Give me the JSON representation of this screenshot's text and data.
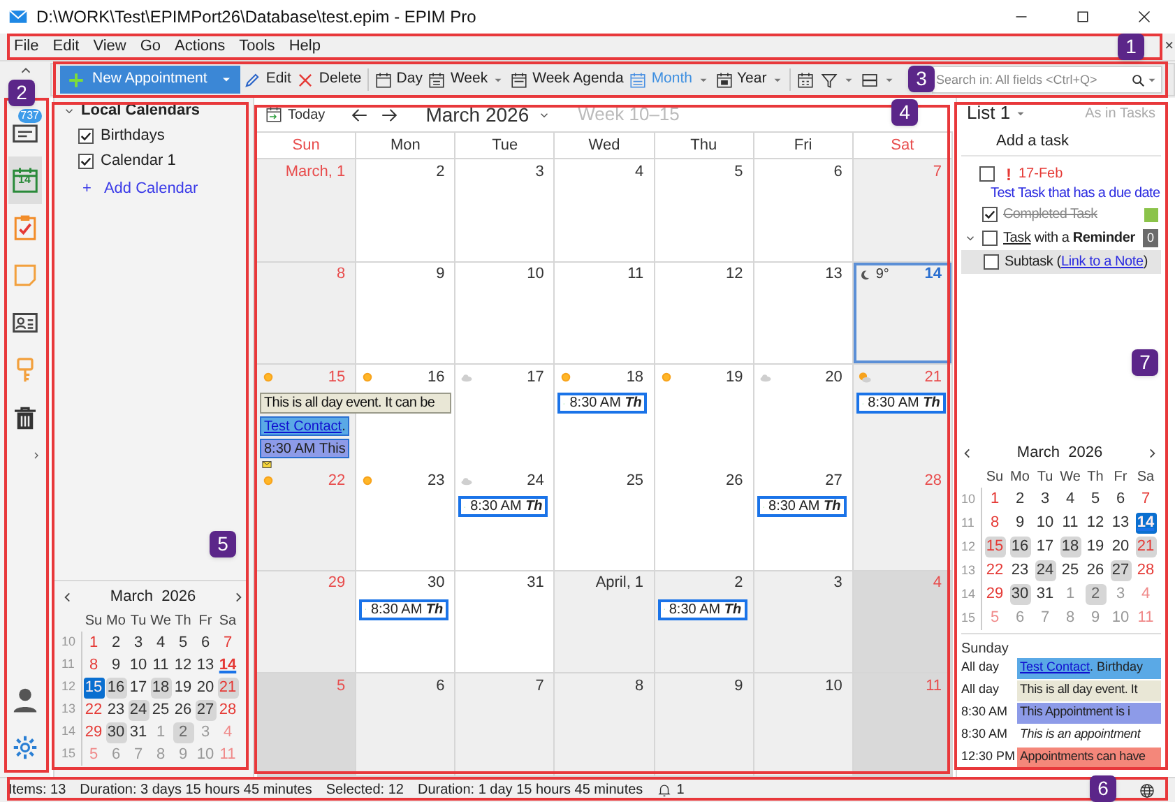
{
  "window": {
    "title": "D:\\WORK\\Test\\EPIMPort26\\Database\\test.epim - EPIM Pro"
  },
  "menu": {
    "items": [
      "File",
      "Edit",
      "View",
      "Go",
      "Actions",
      "Tools",
      "Help"
    ],
    "close_glyph": "×"
  },
  "toolbar": [
    {
      "kind": "new",
      "label": "New Appointment",
      "dropdown": true
    },
    {
      "kind": "edit",
      "label": "Edit",
      "dropdown": false
    },
    {
      "kind": "delete",
      "label": "Delete",
      "dropdown": false
    },
    {
      "kind": "day",
      "label": "Day",
      "dropdown": false,
      "selected": false
    },
    {
      "kind": "week",
      "label": "Week",
      "dropdown": true,
      "selected": false
    },
    {
      "kind": "week-agenda",
      "label": "Week Agenda",
      "dropdown": false,
      "selected": false
    },
    {
      "kind": "month",
      "label": "Month",
      "dropdown": true,
      "selected": true
    },
    {
      "kind": "year",
      "label": "Year",
      "dropdown": true,
      "selected": false
    },
    {
      "kind": "go-to-date",
      "dropdown": false
    },
    {
      "kind": "filter",
      "dropdown": true
    },
    {
      "kind": "layout",
      "dropdown": true
    }
  ],
  "search": {
    "placeholder": "Search in: All fields <Ctrl+Q>"
  },
  "nav": [
    {
      "kind": "mail",
      "badge": "737",
      "selected": false
    },
    {
      "kind": "calendar",
      "date": "14",
      "selected": true
    },
    {
      "kind": "tasks",
      "selected": false
    },
    {
      "kind": "notes",
      "selected": false
    },
    {
      "kind": "contacts",
      "selected": false
    },
    {
      "kind": "passwords",
      "selected": false
    },
    {
      "kind": "trash",
      "selected": false
    },
    {
      "kind": "expand",
      "selected": false
    },
    {
      "kind": "spacer"
    },
    {
      "kind": "account",
      "selected": false
    },
    {
      "kind": "settings",
      "selected": false
    }
  ],
  "left_panel": {
    "tree": {
      "label": "Local Calendars",
      "expanded": true,
      "children": [
        {
          "label": "Birthdays",
          "checked": true
        },
        {
          "label": "Calendar 1",
          "checked": true
        }
      ]
    },
    "add_link": {
      "glyph": "+",
      "label": "Add Calendar"
    },
    "mini_calendar": {
      "month": "March",
      "year": "2026",
      "weekdays": [
        "Su",
        "Mo",
        "Tu",
        "We",
        "Th",
        "Fr",
        "Sa"
      ],
      "weeks": [
        {
          "number": "10",
          "days": [
            {
              "day": "1",
              "kind": "weekend",
              "busy": false,
              "selected": false,
              "today": false
            },
            {
              "day": "2",
              "kind": "weekday",
              "busy": false,
              "selected": false,
              "today": false
            },
            {
              "day": "3",
              "kind": "weekday",
              "busy": false,
              "selected": false,
              "today": false
            },
            {
              "day": "4",
              "kind": "weekday",
              "busy": false,
              "selected": false,
              "today": false
            },
            {
              "day": "5",
              "kind": "weekday",
              "busy": false,
              "selected": false,
              "today": false
            },
            {
              "day": "6",
              "kind": "weekday",
              "busy": false,
              "selected": false,
              "today": false
            },
            {
              "day": "7",
              "kind": "weekend",
              "busy": false,
              "selected": false,
              "today": false
            }
          ]
        },
        {
          "number": "11",
          "days": [
            {
              "day": "8",
              "kind": "weekend",
              "busy": false,
              "selected": false,
              "today": false
            },
            {
              "day": "9",
              "kind": "weekday",
              "busy": false,
              "selected": false,
              "today": false
            },
            {
              "day": "10",
              "kind": "weekday",
              "busy": false,
              "selected": false,
              "today": false
            },
            {
              "day": "11",
              "kind": "weekday",
              "busy": false,
              "selected": false,
              "today": false
            },
            {
              "day": "12",
              "kind": "weekday",
              "busy": false,
              "selected": false,
              "today": false
            },
            {
              "day": "13",
              "kind": "weekday",
              "busy": false,
              "selected": false,
              "today": false
            },
            {
              "day": "14",
              "kind": "weekend",
              "busy": false,
              "selected": false,
              "today": true
            }
          ]
        },
        {
          "number": "12",
          "days": [
            {
              "day": "15",
              "kind": "weekend",
              "busy": false,
              "selected": true,
              "today": false
            },
            {
              "day": "16",
              "kind": "weekday",
              "busy": true,
              "selected": false,
              "today": false
            },
            {
              "day": "17",
              "kind": "weekday",
              "busy": false,
              "selected": false,
              "today": false
            },
            {
              "day": "18",
              "kind": "weekday",
              "busy": true,
              "selected": false,
              "today": false
            },
            {
              "day": "19",
              "kind": "weekday",
              "busy": false,
              "selected": false,
              "today": false
            },
            {
              "day": "20",
              "kind": "weekday",
              "busy": false,
              "selected": false,
              "today": false
            },
            {
              "day": "21",
              "kind": "weekend",
              "busy": true,
              "selected": false,
              "today": false
            }
          ]
        },
        {
          "number": "13",
          "days": [
            {
              "day": "22",
              "kind": "weekend",
              "busy": false,
              "selected": false,
              "today": false
            },
            {
              "day": "23",
              "kind": "weekday",
              "busy": false,
              "selected": false,
              "today": false
            },
            {
              "day": "24",
              "kind": "weekday",
              "busy": true,
              "selected": false,
              "today": false
            },
            {
              "day": "25",
              "kind": "weekday",
              "busy": false,
              "selected": false,
              "today": false
            },
            {
              "day": "26",
              "kind": "weekday",
              "busy": false,
              "selected": false,
              "today": false
            },
            {
              "day": "27",
              "kind": "weekday",
              "busy": true,
              "selected": false,
              "today": false
            },
            {
              "day": "28",
              "kind": "weekend",
              "busy": false,
              "selected": false,
              "today": false
            }
          ]
        },
        {
          "number": "14",
          "days": [
            {
              "day": "29",
              "kind": "weekend",
              "busy": false,
              "selected": false,
              "today": false
            },
            {
              "day": "30",
              "kind": "weekday",
              "busy": true,
              "selected": false,
              "today": false
            },
            {
              "day": "31",
              "kind": "weekday",
              "busy": false,
              "selected": false,
              "today": false
            },
            {
              "day": "1",
              "kind": "other-month",
              "busy": false,
              "selected": false,
              "today": false
            },
            {
              "day": "2",
              "kind": "other-month",
              "busy": true,
              "selected": false,
              "today": false
            },
            {
              "day": "3",
              "kind": "other-month",
              "busy": false,
              "selected": false,
              "today": false
            },
            {
              "day": "4",
              "kind": "other-month-weekend",
              "busy": false,
              "selected": false,
              "today": false
            }
          ]
        },
        {
          "number": "15",
          "days": [
            {
              "day": "5",
              "kind": "other-month-weekend",
              "busy": false,
              "selected": false,
              "today": false
            },
            {
              "day": "6",
              "kind": "other-month",
              "busy": false,
              "selected": false,
              "today": false
            },
            {
              "day": "7",
              "kind": "other-month",
              "busy": false,
              "selected": false,
              "today": false
            },
            {
              "day": "8",
              "kind": "other-month",
              "busy": false,
              "selected": false,
              "today": false
            },
            {
              "day": "9",
              "kind": "other-month",
              "busy": false,
              "selected": false,
              "today": false
            },
            {
              "day": "10",
              "kind": "other-month",
              "busy": false,
              "selected": false,
              "today": false
            },
            {
              "day": "11",
              "kind": "other-month-weekend",
              "busy": false,
              "selected": false,
              "today": false
            }
          ]
        }
      ]
    }
  },
  "calendar": {
    "today_label": "Today",
    "title": "March 2026",
    "week_range": "Week 10–15",
    "weekdays": [
      {
        "label": "Sun",
        "weekend": true
      },
      {
        "label": "Mon",
        "weekend": false
      },
      {
        "label": "Tue",
        "weekend": false
      },
      {
        "label": "Wed",
        "weekend": false
      },
      {
        "label": "Thu",
        "weekend": false
      },
      {
        "label": "Fri",
        "weekend": false
      },
      {
        "label": "Sat",
        "weekend": true
      }
    ],
    "weeks": [
      [
        {
          "day": "March, 1",
          "kind": "weekend",
          "selected": false
        },
        {
          "day": "2",
          "kind": "weekday",
          "selected": false
        },
        {
          "day": "3",
          "kind": "weekday",
          "selected": false
        },
        {
          "day": "4",
          "kind": "weekday",
          "selected": false
        },
        {
          "day": "5",
          "kind": "weekday",
          "selected": false
        },
        {
          "day": "6",
          "kind": "weekday",
          "selected": false
        },
        {
          "day": "7",
          "kind": "weekend",
          "selected": false
        }
      ],
      [
        {
          "day": "8",
          "kind": "weekend",
          "selected": false
        },
        {
          "day": "9",
          "kind": "weekday",
          "selected": false
        },
        {
          "day": "10",
          "kind": "weekday",
          "selected": false
        },
        {
          "day": "11",
          "kind": "weekday",
          "selected": false
        },
        {
          "day": "12",
          "kind": "weekday",
          "selected": false
        },
        {
          "day": "13",
          "kind": "weekday",
          "selected": false
        },
        {
          "day": "14",
          "kind": "weekend",
          "selected": true,
          "weather": {
            "kind": "moon",
            "temp": "9°"
          }
        }
      ],
      [
        {
          "day": "15",
          "kind": "weekend",
          "selected": false,
          "weather": {
            "kind": "sun"
          },
          "events": [
            {
              "kind": "all-day",
              "text": "This is all day event. It can be",
              "continues_next_day": true,
              "color": "#e9e7d6"
            },
            {
              "kind": "birthday",
              "link": "Test Contact",
              "text": ".",
              "color": "#5aa9e6"
            },
            {
              "kind": "appointment",
              "time": "8:30 AM",
              "title": "This",
              "color": "#8d9be8"
            },
            {
              "kind": "more"
            }
          ]
        },
        {
          "day": "16",
          "kind": "weekday",
          "selected": false,
          "weather": {
            "kind": "sun"
          }
        },
        {
          "day": "17",
          "kind": "weekday",
          "selected": false,
          "weather": {
            "kind": "cloud"
          }
        },
        {
          "day": "18",
          "kind": "weekday",
          "selected": false,
          "weather": {
            "kind": "sun"
          },
          "events": [
            {
              "kind": "recurring",
              "time": "8:30 AM",
              "title": "Th"
            }
          ]
        },
        {
          "day": "19",
          "kind": "weekday",
          "selected": false,
          "weather": {
            "kind": "sun"
          }
        },
        {
          "day": "20",
          "kind": "weekday",
          "selected": false,
          "weather": {
            "kind": "cloud"
          }
        },
        {
          "day": "21",
          "kind": "weekend",
          "selected": false,
          "weather": {
            "kind": "partly-cloudy"
          },
          "events": [
            {
              "kind": "recurring",
              "time": "8:30 AM",
              "title": "Th"
            }
          ]
        }
      ],
      [
        {
          "day": "22",
          "kind": "weekend",
          "selected": false,
          "weather": {
            "kind": "sun"
          }
        },
        {
          "day": "23",
          "kind": "weekday",
          "selected": false,
          "weather": {
            "kind": "sun"
          }
        },
        {
          "day": "24",
          "kind": "weekday",
          "selected": false,
          "weather": {
            "kind": "cloud"
          },
          "events": [
            {
              "kind": "recurring",
              "time": "8:30 AM",
              "title": "Th"
            }
          ]
        },
        {
          "day": "25",
          "kind": "weekday",
          "selected": false
        },
        {
          "day": "26",
          "kind": "weekday",
          "selected": false
        },
        {
          "day": "27",
          "kind": "weekday",
          "selected": false,
          "events": [
            {
              "kind": "recurring",
              "time": "8:30 AM",
              "title": "Th"
            }
          ]
        },
        {
          "day": "28",
          "kind": "weekend",
          "selected": false
        }
      ],
      [
        {
          "day": "29",
          "kind": "weekend",
          "selected": false
        },
        {
          "day": "30",
          "kind": "weekday",
          "selected": false,
          "events": [
            {
              "kind": "recurring",
              "time": "8:30 AM",
              "title": "Th"
            }
          ]
        },
        {
          "day": "31",
          "kind": "weekday",
          "selected": false
        },
        {
          "day": "April, 1",
          "kind": "other-month",
          "selected": false
        },
        {
          "day": "2",
          "kind": "other-month",
          "selected": false,
          "events": [
            {
              "kind": "recurring",
              "time": "8:30 AM",
              "title": "Th"
            }
          ]
        },
        {
          "day": "3",
          "kind": "other-month",
          "selected": false
        },
        {
          "day": "4",
          "kind": "other-month-weekend",
          "selected": false
        }
      ],
      [
        {
          "day": "5",
          "kind": "other-month-weekend",
          "selected": false
        },
        {
          "day": "6",
          "kind": "other-month",
          "selected": false
        },
        {
          "day": "7",
          "kind": "other-month",
          "selected": false
        },
        {
          "day": "8",
          "kind": "other-month",
          "selected": false
        },
        {
          "day": "9",
          "kind": "other-month",
          "selected": false
        },
        {
          "day": "10",
          "kind": "other-month",
          "selected": false
        },
        {
          "day": "11",
          "kind": "other-month-weekend",
          "selected": false
        }
      ]
    ]
  },
  "right_panel": {
    "list_title": "List 1",
    "sort_label": "As in Tasks",
    "add_task": "Add a task",
    "tasks": [
      {
        "checked": false,
        "selected": false,
        "priority": "!",
        "due": "17-Feb",
        "title": "Test Task that has a due date"
      },
      {
        "checked": true,
        "selected": false,
        "color": "#8bc34a",
        "title": "Completed Task"
      },
      {
        "checked": false,
        "selected": false,
        "expanded": true,
        "badge": "0",
        "parts": [
          {
            "kind": "underlined",
            "text": "Task"
          },
          {
            "kind": "text",
            "text": " with a "
          },
          {
            "kind": "bold",
            "text": "Reminder"
          }
        ],
        "children": [
          {
            "checked": false,
            "selected": true,
            "parts": [
              {
                "kind": "text",
                "text": "Subtask ("
              },
              {
                "kind": "link",
                "text": "Link to a Note"
              },
              {
                "kind": "text",
                "text": ")"
              }
            ]
          }
        ]
      }
    ],
    "mini_calendar": {
      "month": "March",
      "year": "2026",
      "weekdays": [
        "Su",
        "Mo",
        "Tu",
        "We",
        "Th",
        "Fr",
        "Sa"
      ],
      "weeks": [
        {
          "number": "10",
          "days": [
            {
              "day": "1",
              "kind": "weekend",
              "busy": false,
              "selected": false,
              "today": false
            },
            {
              "day": "2",
              "kind": "weekday",
              "busy": false,
              "selected": false,
              "today": false
            },
            {
              "day": "3",
              "kind": "weekday",
              "busy": false,
              "selected": false,
              "today": false
            },
            {
              "day": "4",
              "kind": "weekday",
              "busy": false,
              "selected": false,
              "today": false
            },
            {
              "day": "5",
              "kind": "weekday",
              "busy": false,
              "selected": false,
              "today": false
            },
            {
              "day": "6",
              "kind": "weekday",
              "busy": false,
              "selected": false,
              "today": false
            },
            {
              "day": "7",
              "kind": "weekend",
              "busy": false,
              "selected": false,
              "today": false
            }
          ]
        },
        {
          "number": "11",
          "days": [
            {
              "day": "8",
              "kind": "weekend",
              "busy": false,
              "selected": false,
              "today": false
            },
            {
              "day": "9",
              "kind": "weekday",
              "busy": false,
              "selected": false,
              "today": false
            },
            {
              "day": "10",
              "kind": "weekday",
              "busy": false,
              "selected": false,
              "today": false
            },
            {
              "day": "11",
              "kind": "weekday",
              "busy": false,
              "selected": false,
              "today": false
            },
            {
              "day": "12",
              "kind": "weekday",
              "busy": false,
              "selected": false,
              "today": false
            },
            {
              "day": "13",
              "kind": "weekday",
              "busy": false,
              "selected": false,
              "today": false
            },
            {
              "day": "14",
              "kind": "weekend",
              "busy": false,
              "selected": true,
              "today": true
            }
          ]
        },
        {
          "number": "12",
          "days": [
            {
              "day": "15",
              "kind": "weekend",
              "busy": true,
              "selected": false,
              "today": false
            },
            {
              "day": "16",
              "kind": "weekday",
              "busy": true,
              "selected": false,
              "today": false
            },
            {
              "day": "17",
              "kind": "weekday",
              "busy": false,
              "selected": false,
              "today": false
            },
            {
              "day": "18",
              "kind": "weekday",
              "busy": true,
              "selected": false,
              "today": false
            },
            {
              "day": "19",
              "kind": "weekday",
              "busy": false,
              "selected": false,
              "today": false
            },
            {
              "day": "20",
              "kind": "weekday",
              "busy": false,
              "selected": false,
              "today": false
            },
            {
              "day": "21",
              "kind": "weekend",
              "busy": true,
              "selected": false,
              "today": false
            }
          ]
        },
        {
          "number": "13",
          "days": [
            {
              "day": "22",
              "kind": "weekend",
              "busy": false,
              "selected": false,
              "today": false
            },
            {
              "day": "23",
              "kind": "weekday",
              "busy": false,
              "selected": false,
              "today": false
            },
            {
              "day": "24",
              "kind": "weekday",
              "busy": true,
              "selected": false,
              "today": false
            },
            {
              "day": "25",
              "kind": "weekday",
              "busy": false,
              "selected": false,
              "today": false
            },
            {
              "day": "26",
              "kind": "weekday",
              "busy": false,
              "selected": false,
              "today": false
            },
            {
              "day": "27",
              "kind": "weekday",
              "busy": true,
              "selected": false,
              "today": false
            },
            {
              "day": "28",
              "kind": "weekend",
              "busy": false,
              "selected": false,
              "today": false
            }
          ]
        },
        {
          "number": "14",
          "days": [
            {
              "day": "29",
              "kind": "weekend",
              "busy": false,
              "selected": false,
              "today": false
            },
            {
              "day": "30",
              "kind": "weekday",
              "busy": true,
              "selected": false,
              "today": false
            },
            {
              "day": "31",
              "kind": "weekday",
              "busy": false,
              "selected": false,
              "today": false
            },
            {
              "day": "1",
              "kind": "other-month",
              "busy": false,
              "selected": false,
              "today": false
            },
            {
              "day": "2",
              "kind": "other-month",
              "busy": true,
              "selected": false,
              "today": false
            },
            {
              "day": "3",
              "kind": "other-month",
              "busy": false,
              "selected": false,
              "today": false
            },
            {
              "day": "4",
              "kind": "other-month-weekend",
              "busy": false,
              "selected": false,
              "today": false
            }
          ]
        },
        {
          "number": "15",
          "days": [
            {
              "day": "5",
              "kind": "other-month-weekend",
              "busy": false,
              "selected": false,
              "today": false
            },
            {
              "day": "6",
              "kind": "other-month",
              "busy": false,
              "selected": false,
              "today": false
            },
            {
              "day": "7",
              "kind": "other-month",
              "busy": false,
              "selected": false,
              "today": false
            },
            {
              "day": "8",
              "kind": "other-month",
              "busy": false,
              "selected": false,
              "today": false
            },
            {
              "day": "9",
              "kind": "other-month",
              "busy": false,
              "selected": false,
              "today": false
            },
            {
              "day": "10",
              "kind": "other-month",
              "busy": false,
              "selected": false,
              "today": false
            },
            {
              "day": "11",
              "kind": "other-month-weekend",
              "busy": false,
              "selected": false,
              "today": false
            }
          ]
        }
      ]
    },
    "agenda": {
      "day": "Sunday",
      "rows": [
        {
          "time": "All day",
          "kind": "birthday",
          "link": "Test Contact",
          "text": ". Birthday",
          "color": "#5aa9e6"
        },
        {
          "time": "All day",
          "kind": "event",
          "text": "This is all day event. It",
          "color": "#e9e7d6"
        },
        {
          "time": "8:30 AM",
          "kind": "event",
          "text": "This Appointment is i",
          "color": "#8d9be8"
        },
        {
          "time": "8:30 AM",
          "kind": "note",
          "text": "This is an appointment"
        },
        {
          "time": "12:30 PM",
          "kind": "event",
          "text": "Appointments can have",
          "color": "#f4877a"
        }
      ]
    }
  },
  "status_bar": {
    "items": [
      "Items: 13",
      "Duration: 3 days 15 hours 45 minutes",
      "Selected: 12",
      "Duration: 1 day 15 hours 45 minutes"
    ],
    "notifications": "1"
  },
  "annotations": [
    {
      "number": "1"
    },
    {
      "number": "2"
    },
    {
      "number": "3"
    },
    {
      "number": "4"
    },
    {
      "number": "5"
    },
    {
      "number": "6"
    },
    {
      "number": "7"
    }
  ]
}
